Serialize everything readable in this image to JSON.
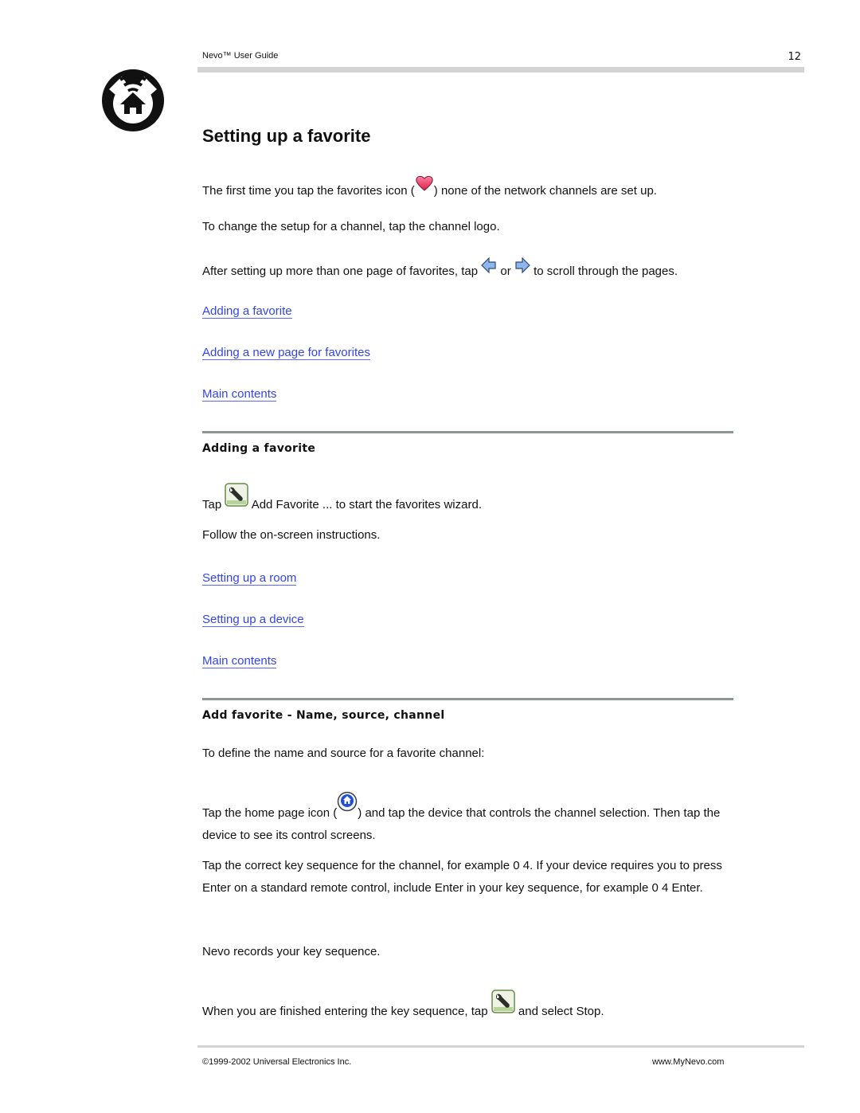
{
  "header": {
    "doc_title": "Nevo™ User Guide",
    "page_number": "12"
  },
  "page_title": "Setting up a favorite",
  "intro": {
    "p1_before": "The first time you tap the favorites icon (",
    "p1_icon": "heart-icon",
    "p1_after": ") none of the network channels are set up.",
    "p2": "To change the setup for a channel, tap the channel logo.",
    "p3_before": "After setting up more than one page of favorites, tap",
    "p3_icon_prev": "arrow-left-icon",
    "p3_middle": "or",
    "p3_icon_next": "arrow-right-icon",
    "p3_after": "to scroll through the pages.",
    "links": [
      {
        "label": "Adding a favorite"
      },
      {
        "label": "Adding a new page for favorites"
      },
      {
        "label": "Main contents"
      }
    ]
  },
  "section_adding": {
    "heading": "Adding a favorite",
    "p1_before": "Tap",
    "p1_icon": "wrench-icon",
    "p1_after": "Add Favorite ... to start the favorites wizard.",
    "p2": "Follow the on-screen instructions.",
    "links": [
      {
        "label": "Setting up a room"
      },
      {
        "label": "Setting up a device"
      },
      {
        "label": "Main contents"
      }
    ]
  },
  "section_name_source": {
    "heading": "Add favorite - Name, source, channel",
    "p1": "To define the name and source for a favorite channel:",
    "p2_before": "Tap the home page icon (",
    "p2_icon": "home-icon",
    "p2_after": ") and tap the device that controls the channel selection. Then tap the device to see its control screens.",
    "p3": "Tap the correct key sequence for the channel, for example 0 4. If your device requires you to press Enter on a standard remote control, include Enter in your key sequence, for example 0 4 Enter.",
    "p4": "Nevo records your key sequence.",
    "p5_before": "When you are finished entering the key sequence, tap",
    "p5_icon": "wrench-icon",
    "p5_after": "and select Stop."
  },
  "footer": {
    "copyright": "©1999-2002 Universal Electronics Inc.",
    "website": "www.MyNevo.com"
  },
  "colors": {
    "link": "#3344ee",
    "rule": "#8e9694",
    "heart": "#e8335a",
    "arrow": "#7aa7e8",
    "home_icon_blue": "#1f4fd6"
  }
}
